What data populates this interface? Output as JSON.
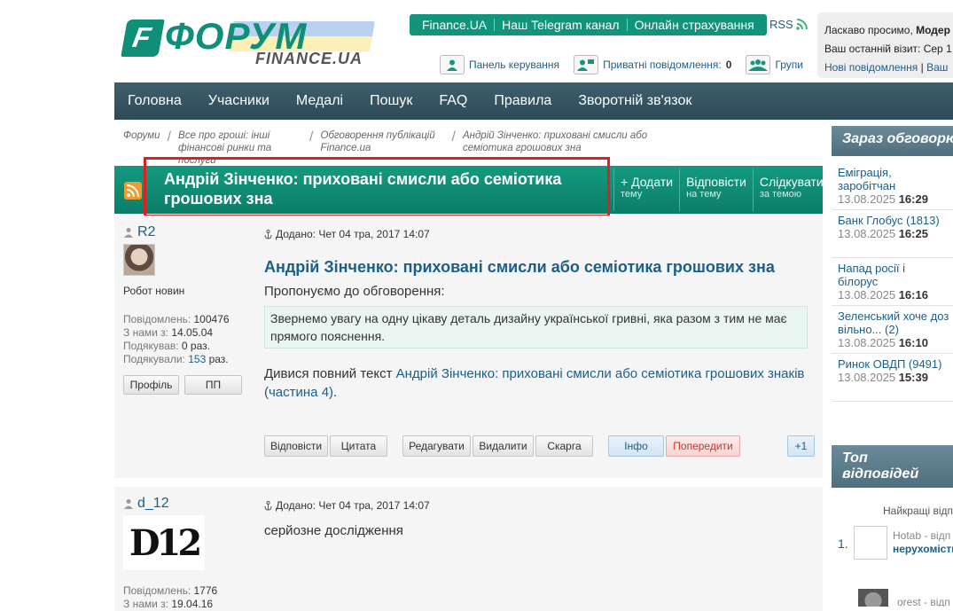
{
  "logo": {
    "main": "ФОРУМ",
    "sub": "FINANCE.UA"
  },
  "toplinks": [
    "Finance.UA",
    "Наш Telegram канал",
    "Онлайн страхування"
  ],
  "rss_label": "RSS",
  "navicons": {
    "panel": "Панель керування",
    "pm": "Приватні повідомлення:",
    "pm_count": "0",
    "groups": "Групи"
  },
  "userbox": {
    "welcome_prefix": "Ласкаво просимо,",
    "welcome_name": "Модер",
    "last_visit": "Ваш останній візит: Сер 1",
    "new_messages": "Нові повідомлення",
    "separator": "|",
    "more": "Ваш"
  },
  "mainnav": [
    "Головна",
    "Учасники",
    "Медалі",
    "Пошук",
    "FAQ",
    "Правила",
    "Зворотній зв'язок"
  ],
  "breadcrumb": [
    "Форуми",
    "Все про гроші: інші фінансові ринки та послуги",
    "Обговорення публікацій Finance.ua",
    "Андрій Зінченко: приховані смисли або семіотика грошових зна"
  ],
  "topic": {
    "title": "Андрій Зінченко: приховані смисли або семіотика грошових зна",
    "actions": [
      {
        "main": "+ Додати",
        "sub": "тему"
      },
      {
        "main": "Відповісти",
        "sub": "на тему"
      },
      {
        "main": "Слідкувати",
        "sub": "за темою"
      }
    ]
  },
  "posts": [
    {
      "author": "R2",
      "rank": "Робот новин",
      "stats": [
        {
          "label": "Повідомлень:",
          "value": "100476"
        },
        {
          "label": "З нами з:",
          "value": "14.05.04"
        },
        {
          "label": "Подякував:",
          "value": "0 раз."
        },
        {
          "label": "Подякували:",
          "value": "153",
          "suffix": "раз."
        }
      ],
      "profile_btn": "Профіль",
      "pm_btn": "ПП",
      "posted": "Додано: Чет 04 тра, 2017 14:07",
      "title": "Андрій Зінченко: приховані смисли або семіотика грошових зна",
      "intro": "Пропонуємо до обговорення:",
      "quote": "Звернемо увагу на одну цікаву деталь дизайну української гривні, яка разом з тим не має прямого пояснення.",
      "full_prefix": "Дивися повний текст",
      "full_link": "Андрій Зінченко: приховані смисли або семіотика грошових знаків (частина 4)",
      "full_suffix": ".",
      "buttons": {
        "reply": "Відповісти",
        "quote": "Цитата",
        "edit": "Редагувати",
        "delete": "Видалити",
        "report": "Скарга",
        "info": "Інфо",
        "warn": "Попередити",
        "plus": "+1"
      }
    },
    {
      "author": "d_12",
      "avatar_text": "D12",
      "posted": "Додано: Чет 04 тра, 2017 14:07",
      "text": "серйозне дослідження",
      "stats": [
        {
          "label": "Повідомлень:",
          "value": "1776"
        },
        {
          "label": "З нами з:",
          "value": "19.04.16"
        }
      ]
    }
  ],
  "sidebar": {
    "discuss_title": "Зараз обговорюю",
    "discuss": [
      {
        "title": "Еміграція, заробітчан",
        "date": "13.08.2025",
        "time": "16:29"
      },
      {
        "title": "Банк Глобус (1813)",
        "date": "13.08.2025",
        "time": "16:25"
      },
      {
        "title": "Напад росії і білорус",
        "date": "13.08.2025",
        "time": "16:16"
      },
      {
        "title": "Зеленський хоче доз вільно... (2)",
        "date": "13.08.2025",
        "time": "16:10"
      },
      {
        "title": "Ринок ОВДП (9491)",
        "date": "13.08.2025",
        "time": "15:39"
      }
    ],
    "top_title_1": "Топ",
    "top_title_2": "відповідей",
    "best_caption": "Найкращі відп",
    "best": [
      {
        "num": "1.",
        "author": "Hotab - відп",
        "topic": "нерухомість"
      }
    ],
    "best2_author": "orest - відп"
  },
  "colors": {
    "teal": "#11947b",
    "nav": "#2d4a57",
    "link": "#1a5f8a",
    "highlight": "#e02020"
  }
}
